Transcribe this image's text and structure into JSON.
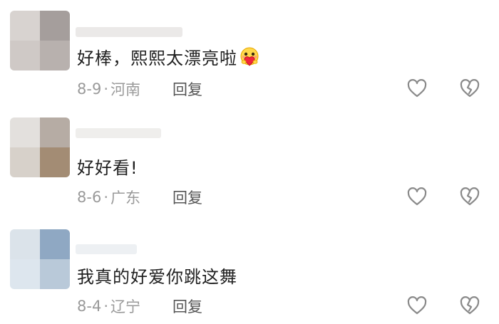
{
  "comments": [
    {
      "text": "好棒，熙熙太漂亮啦",
      "emoji": "heart-hug-emoji",
      "date": "8-9",
      "separator": "·",
      "location": "河南",
      "reply_label": "回复",
      "avatar_colors": [
        "#d8d3d0",
        "#a59e9c",
        "#cfc9c6",
        "#b8b1ae"
      ],
      "name_blur_color": "#ebe9e8"
    },
    {
      "text": "好好看!",
      "emoji": "",
      "date": "8-6",
      "separator": "·",
      "location": "广东",
      "reply_label": "回复",
      "avatar_colors": [
        "#e3e0dd",
        "#b6aca4",
        "#d7d1ca",
        "#a38c74"
      ],
      "name_blur_color": "#efeeec"
    },
    {
      "text": "我真的好爱你跳这舞",
      "emoji": "",
      "date": "8-4",
      "separator": "·",
      "location": "辽宁",
      "reply_label": "回复",
      "avatar_colors": [
        "#dbe3ea",
        "#8fa8c3",
        "#dde6ee",
        "#b9c9d9"
      ],
      "name_blur_color": "#edf0f3"
    }
  ],
  "icons": {
    "like": "heart-outline-icon",
    "dislike": "broken-heart-icon"
  },
  "colors": {
    "text": "#1f1f1f",
    "meta": "#9a9a9a",
    "reply": "#555555",
    "icon": "#8a8a8a"
  }
}
